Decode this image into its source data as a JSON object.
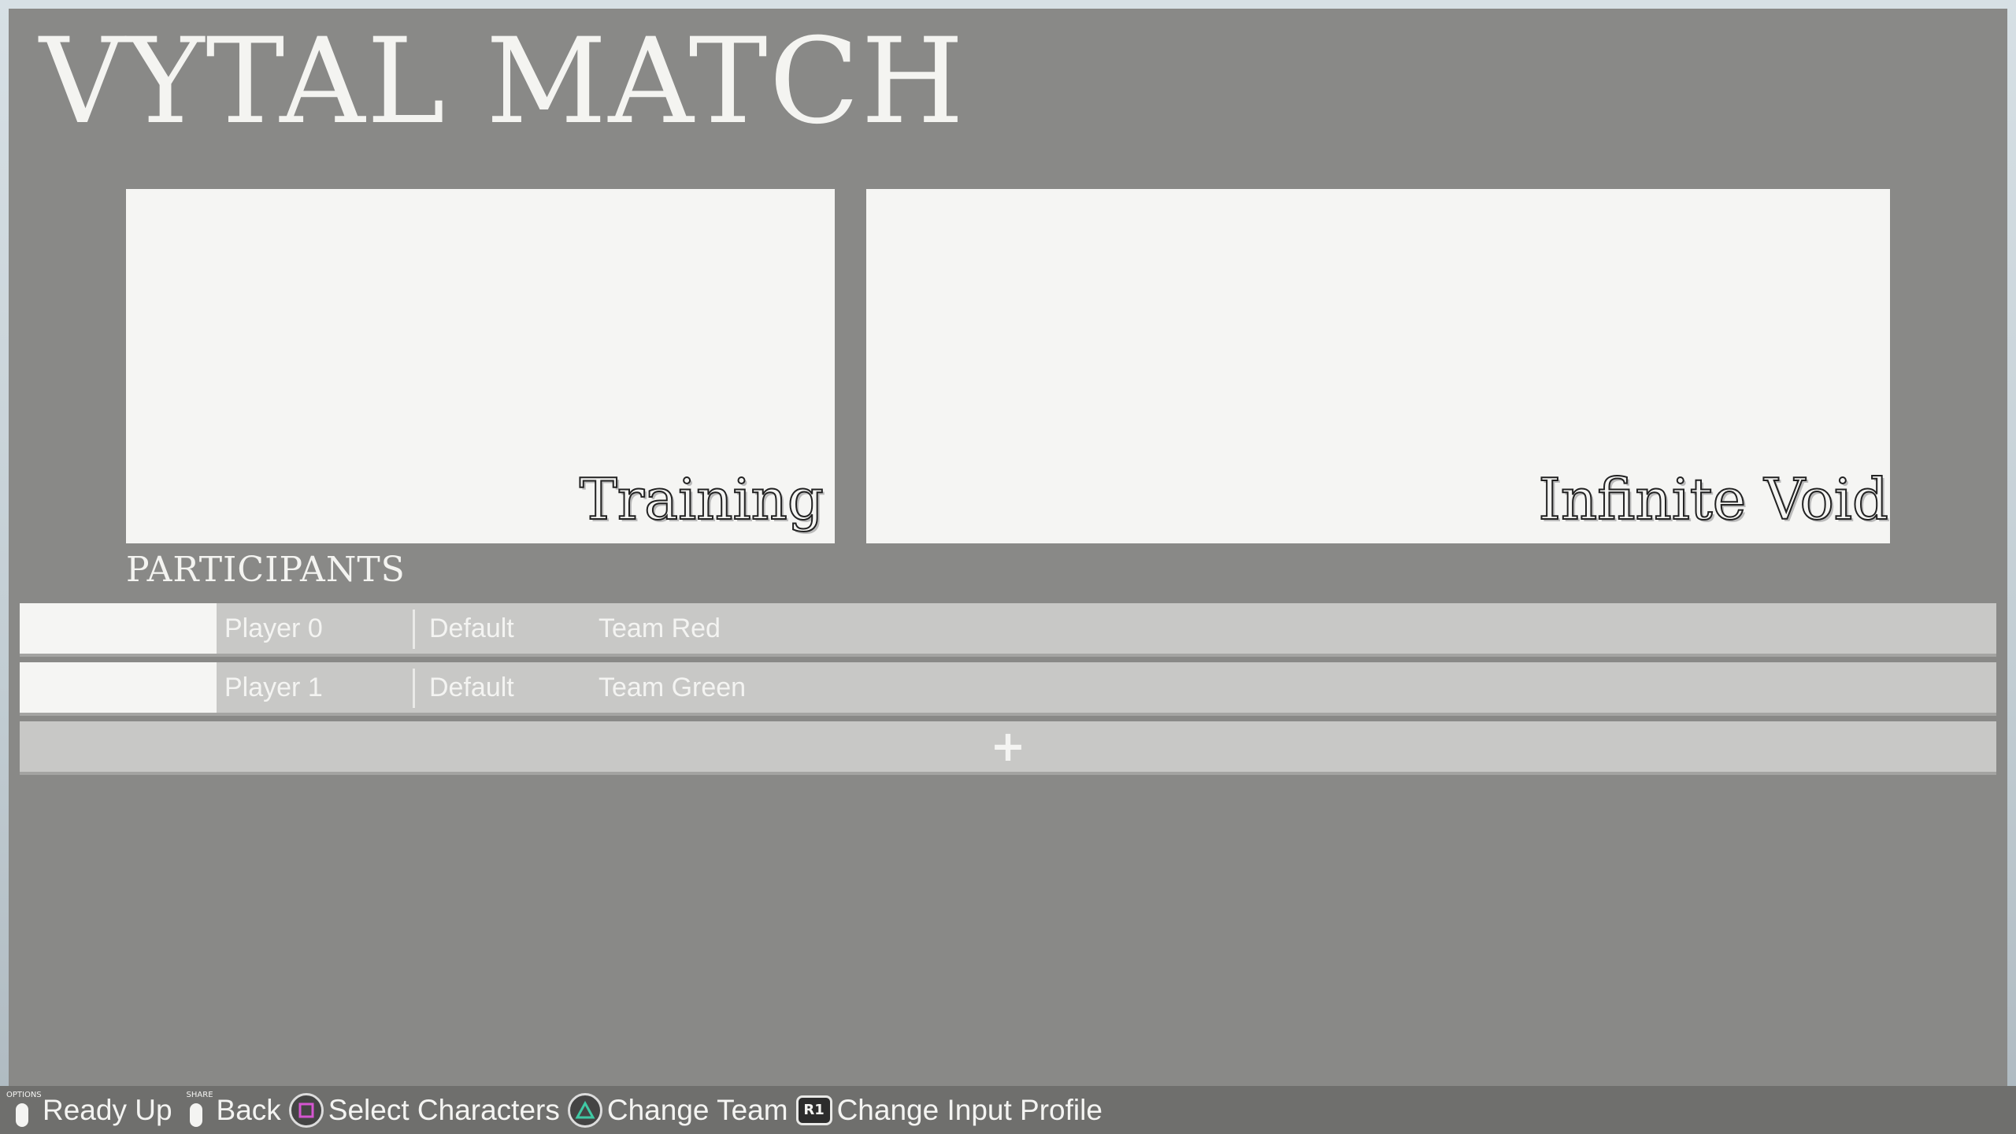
{
  "title": "VYTAL MATCH",
  "mode": {
    "label": "Training"
  },
  "stage": {
    "label": "Infinite Void"
  },
  "participants": {
    "heading": "PARTICIPANTS",
    "rows": [
      {
        "name": "Player 0",
        "profile": "Default",
        "team": "Team Red"
      },
      {
        "name": "Player 1",
        "profile": "Default",
        "team": "Team Green"
      }
    ],
    "add_label": "+"
  },
  "controls": [
    {
      "icon": "options-button-icon",
      "caption": "OPTIONS",
      "label": "Ready Up"
    },
    {
      "icon": "share-button-icon",
      "caption": "SHARE",
      "label": "Back"
    },
    {
      "icon": "square-button-icon",
      "color": "#d455d0",
      "label": "Select Characters"
    },
    {
      "icon": "triangle-button-icon",
      "color": "#3fc9a4",
      "label": "Change Team"
    },
    {
      "icon": "r1-button-icon",
      "caption": "R1",
      "label": "Change Input Profile"
    }
  ]
}
